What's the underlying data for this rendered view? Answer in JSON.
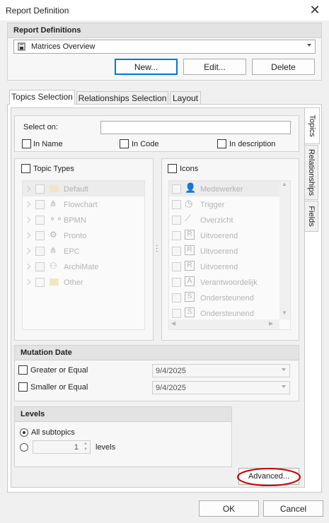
{
  "window": {
    "title": "Report Definition",
    "close_glyph": "✕"
  },
  "report_definitions": {
    "header": "Report Definitions",
    "selected": "Matrices Overview",
    "buttons": {
      "new": "New...",
      "edit": "Edit...",
      "delete": "Delete"
    }
  },
  "tabs": [
    "Topics Selection",
    "Relationships Selection",
    "Layout"
  ],
  "side_tabs": [
    "Topics",
    "Relationships",
    "Fields"
  ],
  "select_on": {
    "label": "Select on:",
    "value": "",
    "in_name": "In Name",
    "in_code": "In Code",
    "in_description": "In description"
  },
  "topic_types": {
    "label": "Topic Types",
    "items": [
      "Default",
      "Flowchart",
      "BPMN",
      "Pronto",
      "EPC",
      "ArchiMate",
      "Other"
    ]
  },
  "icons": {
    "label": "Icons",
    "items": [
      {
        "label": "Medewerker",
        "icon": "person-icon"
      },
      {
        "label": "Trigger",
        "icon": "clock-icon"
      },
      {
        "label": "Overzicht",
        "icon": "chart-icon"
      },
      {
        "label": "Uitvoerend",
        "icon": "r-icon"
      },
      {
        "label": "Uitvoerend",
        "icon": "r-icon"
      },
      {
        "label": "Uitvoerend",
        "icon": "r-icon"
      },
      {
        "label": "Verantwoordelijk",
        "icon": "a-icon"
      },
      {
        "label": "Ondersteunend",
        "icon": "s-icon"
      },
      {
        "label": "Ondersteunend",
        "icon": "s-icon"
      }
    ]
  },
  "mutation_date": {
    "header": "Mutation Date",
    "greater_label": "Greater or Equal",
    "greater_value": "9/4/2025",
    "smaller_label": "Smaller or Equal",
    "smaller_value": "9/4/2025"
  },
  "levels": {
    "header": "Levels",
    "all_subtopics": "All subtopics",
    "levels_value": "1",
    "levels_label": "levels"
  },
  "advanced_button": "Advanced...",
  "footer": {
    "ok": "OK",
    "cancel": "Cancel"
  },
  "colors": {
    "highlight_ring": "#cc0000",
    "focus": "#0078d7"
  }
}
